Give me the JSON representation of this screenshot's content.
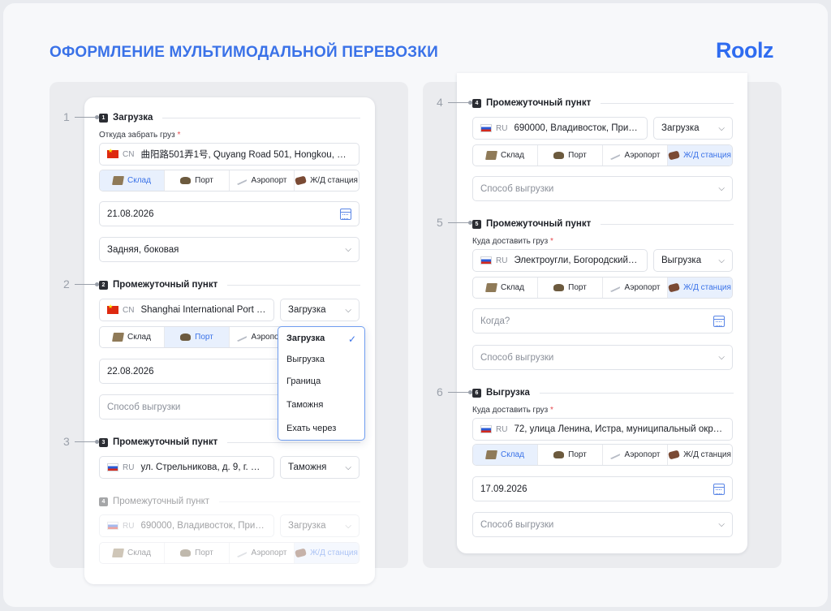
{
  "page_title": "ОФОРМЛЕНИЕ МУЛЬТИМОДАЛЬНОЙ ПЕРЕВОЗКИ",
  "logo": "Roolz",
  "step_numbers": [
    "1",
    "2",
    "3",
    "4",
    "5",
    "6"
  ],
  "modes": {
    "warehouse": "Склад",
    "port": "Порт",
    "airport": "Аэропорт",
    "rail": "Ж/Д станция"
  },
  "icons": {
    "warehouse": "warehouse-icon",
    "port": "port-ship-icon",
    "airport": "airplane-icon",
    "rail": "rail-train-icon",
    "calendar": "calendar-icon",
    "chevron": "chevron-down-icon",
    "check": "check-icon"
  },
  "colors": {
    "accent": "#3a72e8",
    "active_mode_bg": "#e8f0fd",
    "required": "#e5484d"
  },
  "left": {
    "s1": {
      "badge": "1",
      "title": "Загрузка",
      "label": "Откуда забрать груз",
      "country": "CN",
      "address": "曲阳路501弄1号, Quyang Road 501, Hongkou, Sha...",
      "active_mode": "warehouse",
      "date": "21.08.2026",
      "unload": "Задняя, боковая"
    },
    "s2": {
      "badge": "2",
      "title": "Промежуточный пункт",
      "country": "CN",
      "address": "Shanghai International Port (...",
      "op": "Загрузка",
      "active_mode": "port",
      "date": "22.08.2026",
      "method_placeholder": "Способ выгрузки"
    },
    "dropdown": {
      "items": [
        "Загрузка",
        "Выгрузка",
        "Граница",
        "Таможня",
        "Ехать через"
      ],
      "selected": "Загрузка"
    },
    "s3": {
      "badge": "3",
      "title": "Промежуточный пункт",
      "country": "RU",
      "address": "ул. Стрельникова, д. 9, г. Вл...",
      "op": "Таможня"
    },
    "s4": {
      "badge": "4",
      "title": "Промежуточный пункт",
      "country": "RU",
      "address": "690000, Владивосток, Прим...",
      "op": "Загрузка",
      "active_mode": "rail"
    }
  },
  "right": {
    "s4": {
      "badge": "4",
      "title": "Промежуточный пункт",
      "country": "RU",
      "address": "690000, Владивосток, Прим...",
      "op": "Загрузка",
      "active_mode": "rail",
      "method_placeholder": "Способ выгрузки"
    },
    "s5": {
      "badge": "5",
      "title": "Промежуточный пункт",
      "label": "Куда доставить груз",
      "country": "RU",
      "address": "Электроугли, Богородский г...",
      "op": "Выгрузка",
      "active_mode": "rail",
      "date_placeholder": "Когда?",
      "method_placeholder": "Способ выгрузки"
    },
    "s6": {
      "badge": "6",
      "title": "Выгрузка",
      "label": "Куда доставить груз",
      "country": "RU",
      "address": "72, улица Ленина, Истра, муниципальный округ...",
      "active_mode": "warehouse",
      "date": "17.09.2026",
      "method_placeholder": "Способ выгрузки"
    }
  }
}
